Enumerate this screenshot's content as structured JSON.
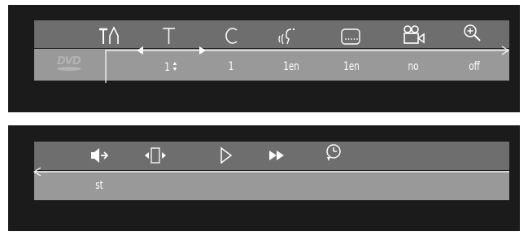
{
  "top_menu": {
    "icons": [
      {
        "name": "setup-icon"
      },
      {
        "name": "title-icon"
      },
      {
        "name": "chapter-icon"
      },
      {
        "name": "audio-icon"
      },
      {
        "name": "subtitle-icon"
      },
      {
        "name": "camera-angle-icon"
      },
      {
        "name": "zoom-icon"
      }
    ],
    "logo_text": "DVD",
    "values": {
      "title": "1",
      "chapter": "1",
      "audio": "1en",
      "subtitle": "1en",
      "angle": "no",
      "zoom": "off"
    }
  },
  "bottom_menu": {
    "icons": [
      {
        "name": "sound-icon"
      },
      {
        "name": "frame-icon"
      },
      {
        "name": "play-icon"
      },
      {
        "name": "fast-forward-icon"
      },
      {
        "name": "timer-icon"
      }
    ],
    "values": {
      "sound": "st"
    }
  },
  "colors": {
    "background": "#1b1b1b",
    "bar_dark": "#6e6e6e",
    "bar_light": "#999999",
    "foreground": "#ffffff"
  }
}
